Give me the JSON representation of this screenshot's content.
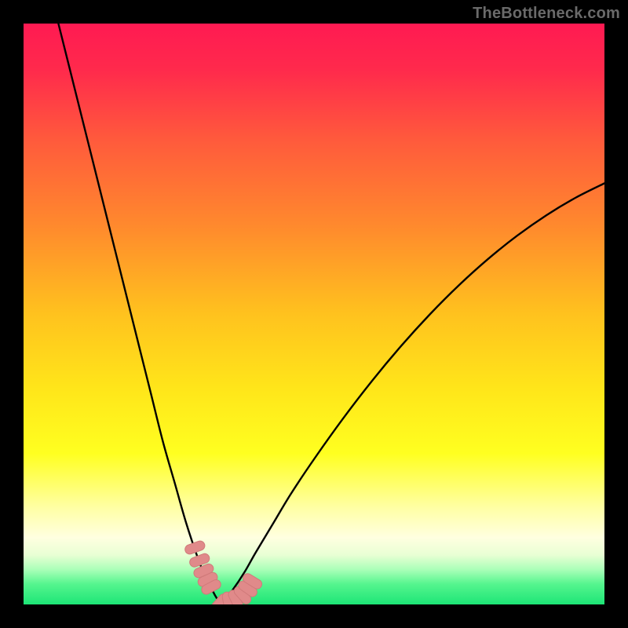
{
  "watermark": "TheBottleneck.com",
  "colors": {
    "gradient_stops": [
      {
        "offset": 0.0,
        "color": "#ff1a52"
      },
      {
        "offset": 0.08,
        "color": "#ff2a4c"
      },
      {
        "offset": 0.2,
        "color": "#ff5a3c"
      },
      {
        "offset": 0.35,
        "color": "#ff8a2d"
      },
      {
        "offset": 0.5,
        "color": "#ffc21e"
      },
      {
        "offset": 0.63,
        "color": "#ffe61a"
      },
      {
        "offset": 0.74,
        "color": "#ffff20"
      },
      {
        "offset": 0.83,
        "color": "#ffffa0"
      },
      {
        "offset": 0.885,
        "color": "#ffffe0"
      },
      {
        "offset": 0.915,
        "color": "#e8ffd4"
      },
      {
        "offset": 0.94,
        "color": "#aaffb8"
      },
      {
        "offset": 0.965,
        "color": "#55f58e"
      },
      {
        "offset": 1.0,
        "color": "#1de576"
      }
    ],
    "curve_stroke": "#000000",
    "marker_fill": "#e08a8a",
    "marker_stroke": "#d07a7a"
  },
  "chart_data": {
    "type": "line",
    "title": "",
    "xlabel": "",
    "ylabel": "",
    "xlim": [
      0,
      100
    ],
    "ylim": [
      0,
      100
    ],
    "grid": false,
    "description": "Bottleneck percentage curve: two branches falling from ~100% at the extremes toward ~0% at the optimal match point (~34 on the x-axis). Highlighted pink segment near the trough marks the recommended range.",
    "series": [
      {
        "name": "left-branch",
        "x": [
          6,
          8,
          10,
          12,
          14,
          16,
          18,
          20,
          22,
          24,
          26,
          28,
          30,
          31,
          32,
          33,
          34
        ],
        "values": [
          100,
          92,
          84,
          76,
          68,
          60,
          52,
          44,
          36,
          28,
          21,
          14,
          8,
          5.5,
          3.5,
          1.5,
          0
        ]
      },
      {
        "name": "right-branch",
        "x": [
          34,
          36,
          38,
          40,
          43,
          46,
          50,
          55,
          60,
          65,
          70,
          75,
          80,
          85,
          90,
          95,
          100
        ],
        "values": [
          0,
          2.5,
          5.5,
          9,
          14,
          19,
          25,
          32,
          38.5,
          44.5,
          50,
          55,
          59.5,
          63.5,
          67,
          70,
          72.5
        ]
      }
    ],
    "highlight_points": {
      "name": "near-optimal-markers",
      "x": [
        29.5,
        30.3,
        31.0,
        31.7,
        32.3,
        33.8,
        35.2,
        36.5,
        37.7,
        38.6,
        39.4
      ],
      "values": [
        9.8,
        7.6,
        5.8,
        4.3,
        3.0,
        0.3,
        0.4,
        0.8,
        1.6,
        2.7,
        4.0
      ]
    }
  }
}
